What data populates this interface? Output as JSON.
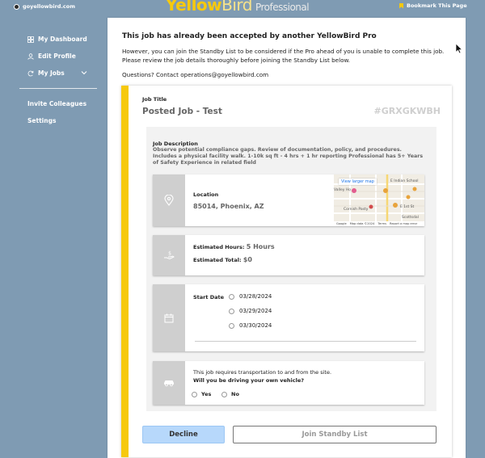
{
  "header": {
    "site": "goyellowbird.com",
    "brand_main": "Yellow",
    "brand_thin": "Bird",
    "brand_suffix": "Professional",
    "bookmark": "Bookmark This Page"
  },
  "sidebar": {
    "items": [
      {
        "label": "My Dashboard",
        "icon": "dashboard-icon"
      },
      {
        "label": "Edit Profile",
        "icon": "user-icon"
      },
      {
        "label": "My Jobs",
        "icon": "refresh-icon"
      }
    ],
    "secondary": [
      {
        "label": "Invite Colleagues"
      },
      {
        "label": "Settings"
      }
    ]
  },
  "notice": {
    "title": "This job has already been accepted by another YellowBird Pro",
    "body": "However, you can join the Standby List to be considered if the Pro ahead of you is unable to complete this job. Please review the job details thoroughly before joining the Standby List below.",
    "contact": "Questions? Contact operations@goyellowbird.com"
  },
  "job": {
    "title_label": "Job Title",
    "title": "Posted Job - Test",
    "code": "#GRXGKWBH",
    "description_label": "Job Description",
    "description": "Observe potential compliance gaps. Review of documentation, policy, and procedures. Includes a physical facility walk. 1-10k sq ft - 4 hrs + 1 hr reporting Professional has 5+ Years of Safety Experience in related field",
    "location_label": "Location",
    "location": "85014, Phoenix, AZ",
    "map": {
      "larger_map": "View larger map",
      "labels": [
        "E Indian School",
        "Cornish Pasty",
        "Valley Ho",
        "Scottsdal",
        "E 1st St"
      ],
      "footer": [
        "Google",
        "Map data ©2024",
        "Terms",
        "Report a map error"
      ]
    },
    "hours_label": "Estimated Hours:",
    "hours_value": "5 Hours",
    "total_label": "Estimated Total:",
    "total_value": "$0",
    "start_label": "Start Date",
    "dates": [
      "03/28/2024",
      "03/29/2024",
      "03/30/2024"
    ],
    "transport_text": "This job requires transportation to and from the site.",
    "transport_question": "Will you be driving your own vehicle?",
    "yes": "Yes",
    "no": "No"
  },
  "actions": {
    "decline": "Decline",
    "standby": "Join Standby List"
  },
  "colors": {
    "accent": "#f6c90e",
    "background": "#7f9bb3",
    "decline": "#b7d8fb"
  }
}
